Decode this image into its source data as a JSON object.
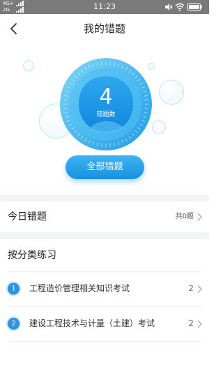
{
  "status_bar": {
    "network_top": "4G+",
    "network_bottom": "2G",
    "time": "11:23"
  },
  "nav": {
    "title": "我的错题",
    "back_icon": "chevron-left-icon"
  },
  "summary": {
    "count": "4",
    "count_label": "错题数",
    "all_button": "全部错题"
  },
  "today": {
    "title": "今日错题",
    "count_text": "共0题"
  },
  "categories": {
    "title": "按分类练习",
    "items": [
      {
        "index": "1",
        "name": "工程造价管理相关知识考试",
        "count": "2"
      },
      {
        "index": "2",
        "name": "建设工程技术与计量（土建）考试",
        "count": "2"
      }
    ]
  },
  "colors": {
    "accent": "#1e90e0",
    "status_bar": "#7a7a7a"
  }
}
